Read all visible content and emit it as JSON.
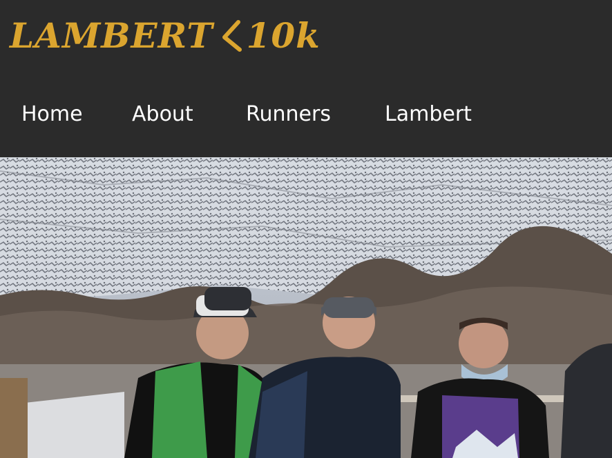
{
  "logo": {
    "text_left": "LAMBERT",
    "text_right": "10k",
    "icon": "chevron-left-icon",
    "color": "#dba52f"
  },
  "nav": {
    "items": [
      {
        "label": "Home"
      },
      {
        "label": "About"
      },
      {
        "label": "Runners"
      },
      {
        "label": "Lambert"
      }
    ]
  },
  "colors": {
    "header_bg": "#2b2b2b",
    "nav_text": "#ffffff",
    "accent": "#dba52f"
  },
  "hero": {
    "image": "group-of-runners-in-front-of-snowy-mountain"
  }
}
